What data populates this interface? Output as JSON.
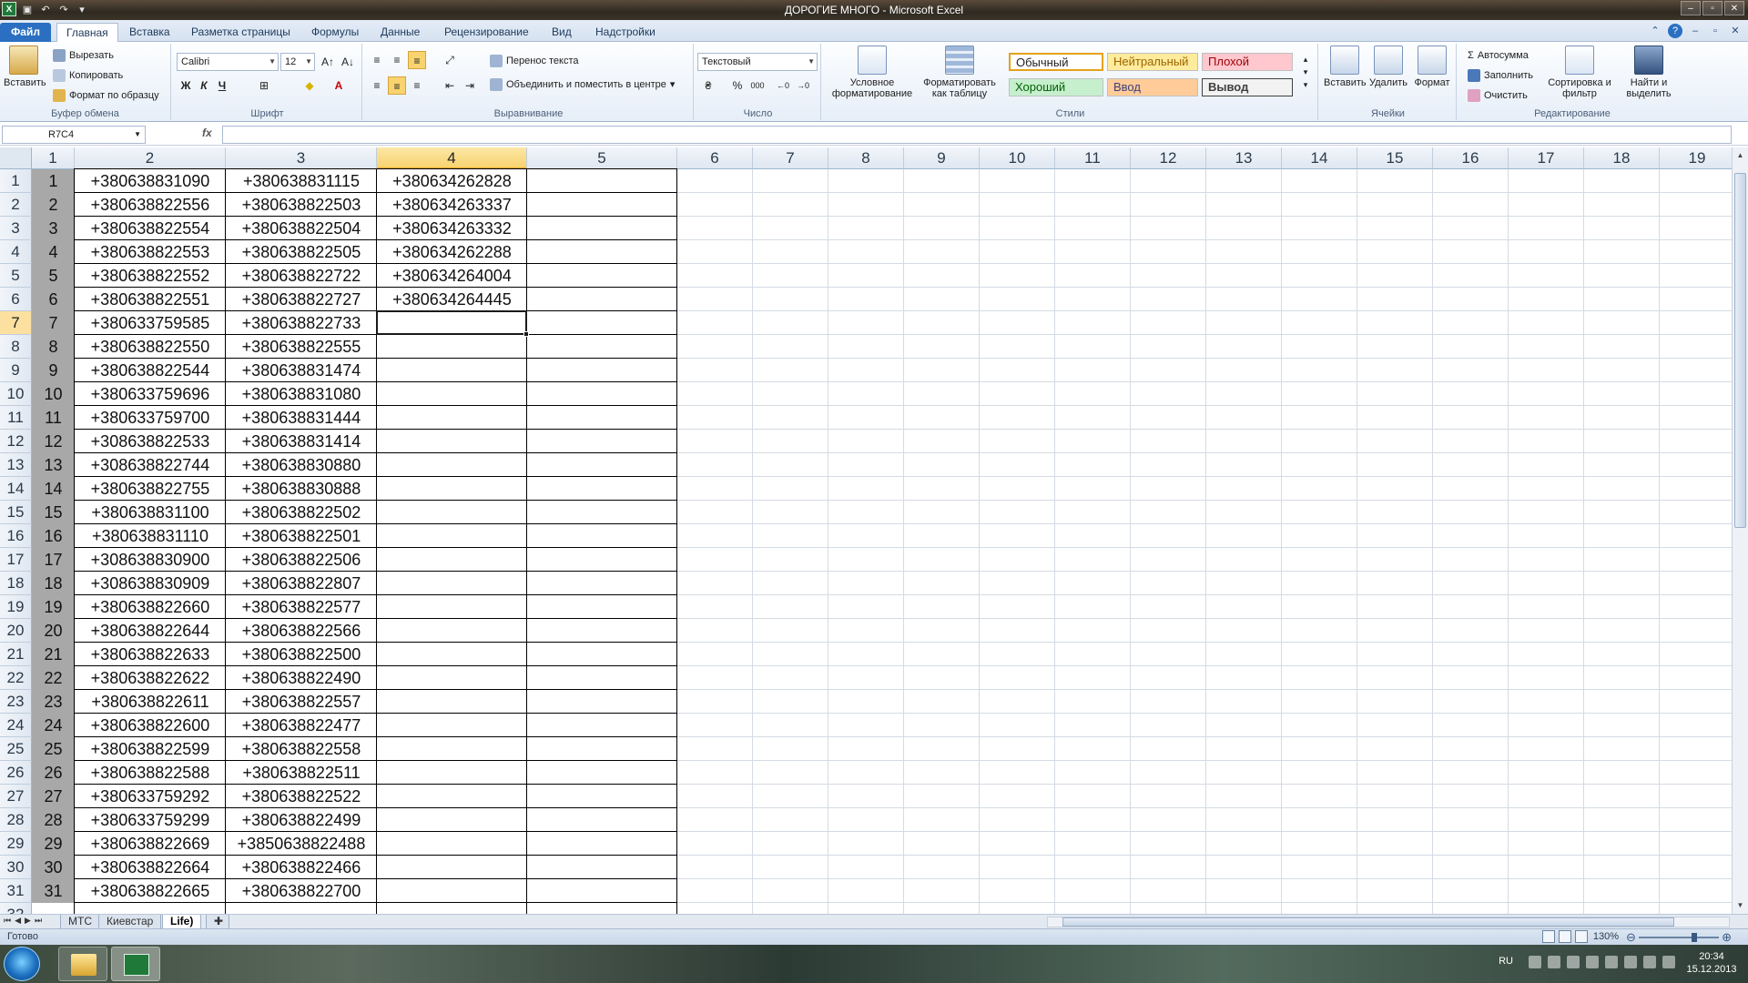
{
  "window": {
    "title": "ДОРОГИЕ МНОГО  -  Microsoft Excel"
  },
  "ribbon_tabs": [
    "Файл",
    "Главная",
    "Вставка",
    "Разметка страницы",
    "Формулы",
    "Данные",
    "Рецензирование",
    "Вид",
    "Надстройки"
  ],
  "clipboard": {
    "paste": "Вставить",
    "cut": "Вырезать",
    "copy": "Копировать",
    "format_painter": "Формат по образцу",
    "label": "Буфер обмена"
  },
  "font": {
    "name": "Calibri",
    "size": "12",
    "bold": "Ж",
    "italic": "К",
    "underline": "Ч",
    "label": "Шрифт"
  },
  "alignment": {
    "wrap_text": "Перенос текста",
    "merge_center": "Объединить и поместить в центре",
    "label": "Выравнивание"
  },
  "number": {
    "format": "Текстовый",
    "percent": "%",
    "thousands": "000",
    "label": "Число"
  },
  "styles": {
    "conditional": "Условное форматирование",
    "as_table": "Форматировать как таблицу",
    "normal": "Обычный",
    "neutral": "Нейтральный",
    "bad": "Плохой",
    "good": "Хороший",
    "input": "Ввод",
    "output": "Вывод",
    "label": "Стили"
  },
  "cells_group": {
    "insert": "Вставить",
    "delete": "Удалить",
    "format": "Формат",
    "label": "Ячейки"
  },
  "editing": {
    "autosum": "Автосумма",
    "fill": "Заполнить",
    "clear": "Очистить",
    "sort": "Сортировка и фильтр",
    "find": "Найти и выделить",
    "label": "Редактирование"
  },
  "formula_bar": {
    "name_box": "R7C4",
    "fx": "fx",
    "formula": ""
  },
  "columns": [
    "1",
    "2",
    "3",
    "4",
    "5",
    "6",
    "7",
    "8",
    "9",
    "10",
    "11",
    "12",
    "13",
    "14",
    "15",
    "16",
    "17",
    "18",
    "19"
  ],
  "selected": {
    "row": 7,
    "col": 4
  },
  "rows": [
    [
      "1",
      "+380638831090",
      "+380638831115",
      "+380634262828"
    ],
    [
      "2",
      "+380638822556",
      "+380638822503",
      "+380634263337"
    ],
    [
      "3",
      "+380638822554",
      "+380638822504",
      "+380634263332"
    ],
    [
      "4",
      "+380638822553",
      "+380638822505",
      "+380634262288"
    ],
    [
      "5",
      "+380638822552",
      "+380638822722",
      "+380634264004"
    ],
    [
      "6",
      "+380638822551",
      "+380638822727",
      "+380634264445"
    ],
    [
      "7",
      "+380633759585",
      "+380638822733",
      ""
    ],
    [
      "8",
      "+380638822550",
      "+380638822555",
      ""
    ],
    [
      "9",
      "+380638822544",
      "+380638831474",
      ""
    ],
    [
      "10",
      "+380633759696",
      "+380638831080",
      ""
    ],
    [
      "11",
      "+380633759700",
      "+380638831444",
      ""
    ],
    [
      "12",
      "+308638822533",
      "+380638831414",
      ""
    ],
    [
      "13",
      "+308638822744",
      "+380638830880",
      ""
    ],
    [
      "14",
      "+380638822755",
      "+380638830888",
      ""
    ],
    [
      "15",
      "+380638831100",
      "+380638822502",
      ""
    ],
    [
      "16",
      "+380638831110",
      "+380638822501",
      ""
    ],
    [
      "17",
      "+308638830900",
      "+380638822506",
      ""
    ],
    [
      "18",
      "+308638830909",
      "+380638822807",
      ""
    ],
    [
      "19",
      "+380638822660",
      "+380638822577",
      ""
    ],
    [
      "20",
      "+380638822644",
      "+380638822566",
      ""
    ],
    [
      "21",
      "+380638822633",
      "+380638822500",
      ""
    ],
    [
      "22",
      "+380638822622",
      "+380638822490",
      ""
    ],
    [
      "23",
      "+380638822611",
      "+380638822557",
      ""
    ],
    [
      "24",
      "+380638822600",
      "+380638822477",
      ""
    ],
    [
      "25",
      "+380638822599",
      "+380638822558",
      ""
    ],
    [
      "26",
      "+380638822588",
      "+380638822511",
      ""
    ],
    [
      "27",
      "+380633759292",
      "+380638822522",
      ""
    ],
    [
      "28",
      "+380633759299",
      "+380638822499",
      ""
    ],
    [
      "29",
      "+380638822669",
      "+3850638822488",
      ""
    ],
    [
      "30",
      "+380638822664",
      "+380638822466",
      ""
    ],
    [
      "31",
      "+380638822665",
      "+380638822700",
      ""
    ]
  ],
  "sheets": [
    "МТС",
    "Киевстар",
    "Life)"
  ],
  "active_sheet": "Life)",
  "status": {
    "ready": "Готово",
    "zoom": "130%"
  },
  "taskbar": {
    "lang": "RU",
    "time": "20:34",
    "date": "15.12.2013"
  },
  "colors": {
    "ribbon_accent": "#2a6fc1",
    "selected_header": "#f8d36f",
    "index_cell": "#a8a8a8"
  }
}
